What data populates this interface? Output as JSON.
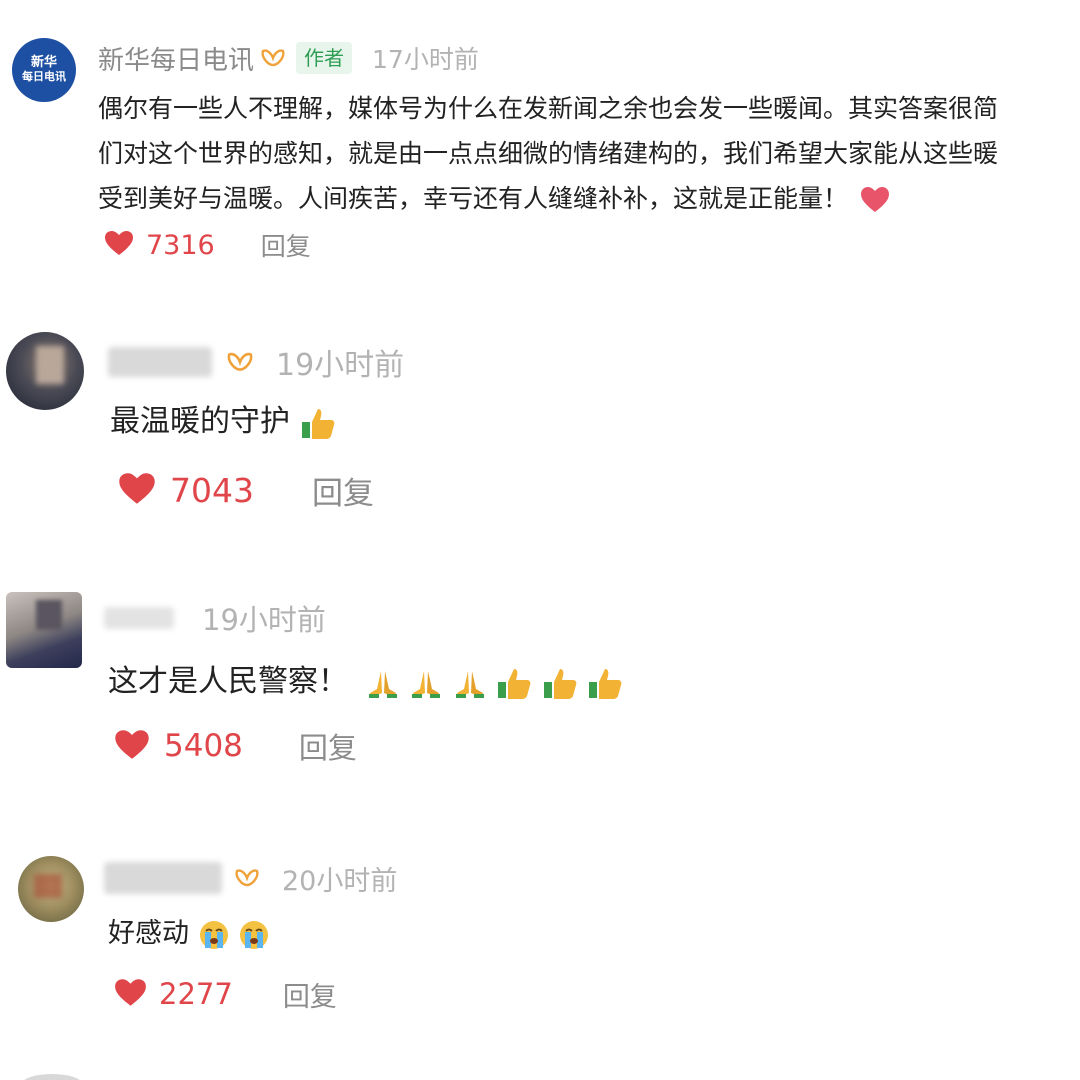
{
  "comments": [
    {
      "name": "新华每日电讯",
      "avatar_text": [
        "新华",
        "每日电讯"
      ],
      "author_tag": "作者",
      "time": "17小时前",
      "text": "偶尔有一些人不理解，媒体号为什么在发新闻之余也会发一些暖闻。其实答案很简们对这个世界的感知，就是由一点点细微的情绪建构的，我们希望大家能从这些暖受到美好与温暖。人间疾苦，幸亏还有人缝缝补补，这就是正能量！",
      "text_lines": [
        "偶尔有一些人不理解，媒体号为什么在发新闻之余也会发一些暖闻。其实答案很简",
        "们对这个世界的感知，就是由一点点细微的情绪建构的，我们希望大家能从这些暖",
        "受到美好与温暖。人间疾苦，幸亏还有人缝缝补补，这就是正能量！"
      ],
      "emoji": "heart",
      "likes": "7316",
      "reply": "回复"
    },
    {
      "time": "19小时前",
      "text": "最温暖的守护",
      "emoji": "thumbs-up",
      "likes": "7043",
      "reply": "回复"
    },
    {
      "time": "19小时前",
      "text": "这才是人民警察！",
      "emoji": "pray-x3-thumbs-up-x3",
      "likes": "5408",
      "reply": "回复"
    },
    {
      "time": "20小时前",
      "text": "好感动",
      "emoji": "crying-face-x2",
      "likes": "2277",
      "reply": "回复"
    }
  ],
  "colors": {
    "like": "#e0454a",
    "author_tag_bg": "#e8f5ec",
    "author_tag_text": "#2f9e55",
    "badge": "#f0a23a",
    "time": "#b3b3b3",
    "avatar_brand": "#1d4fa3"
  },
  "icons": [
    "badge-icon",
    "heart-icon",
    "thumbs-up-icon",
    "pray-icon",
    "crying-face-icon"
  ]
}
